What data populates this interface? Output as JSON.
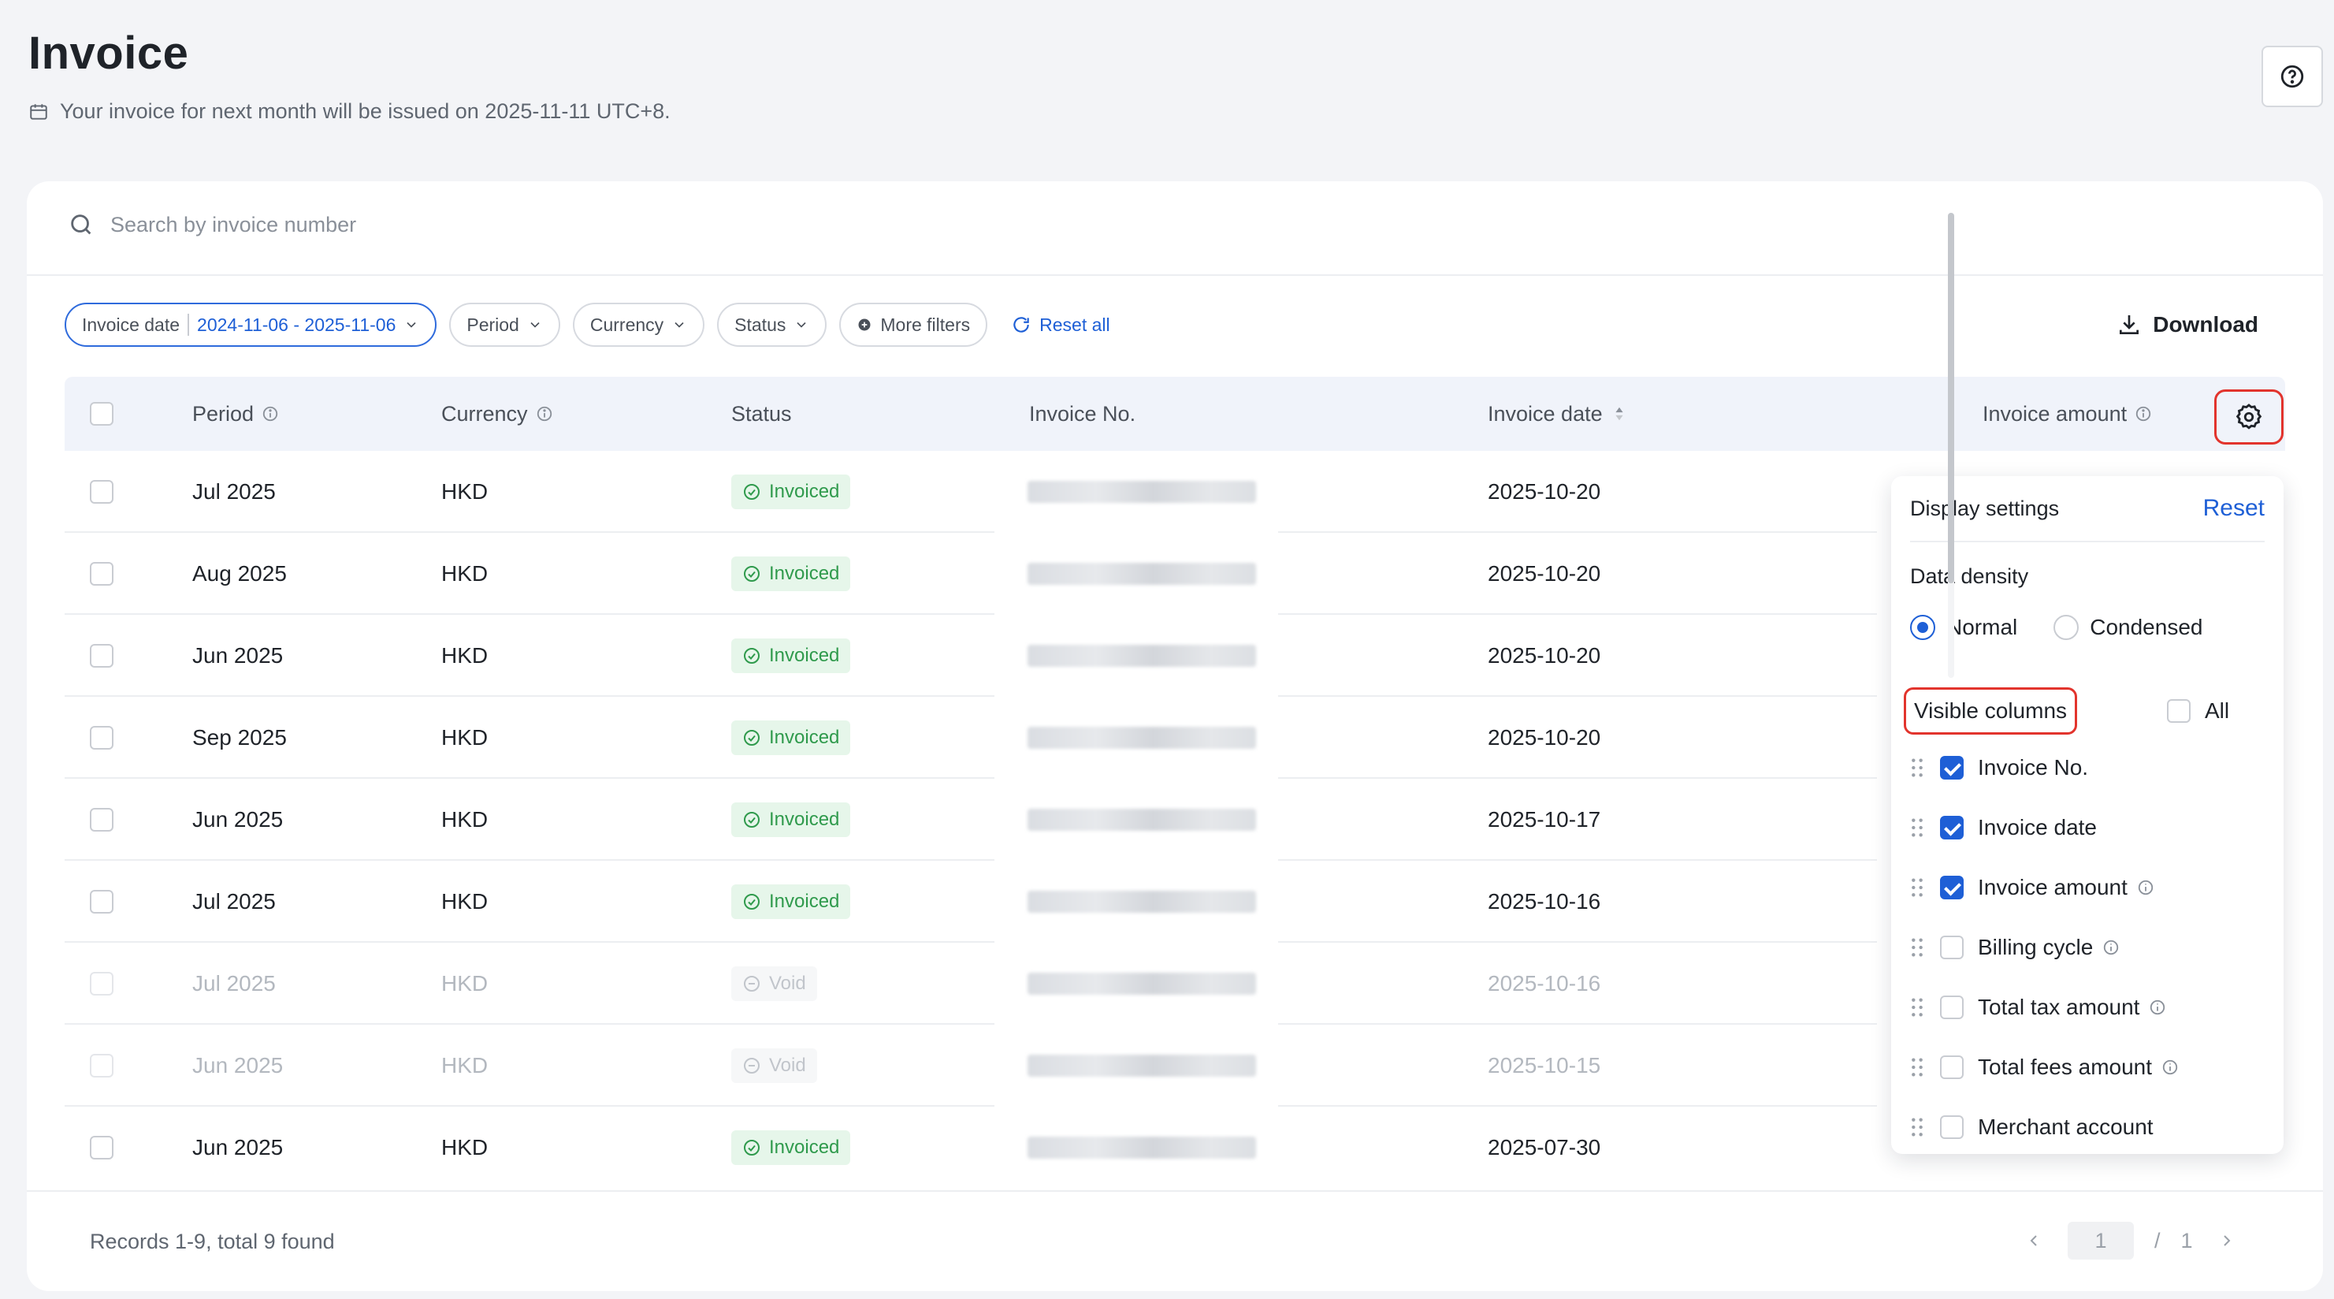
{
  "header": {
    "title": "Invoice",
    "subtitle": "Your invoice for next month will be issued on 2025-11-11 UTC+8."
  },
  "search": {
    "placeholder": "Search by invoice number"
  },
  "filters": {
    "invoice_date_label": "Invoice date",
    "invoice_date_value": "2024-11-06 - 2025-11-06",
    "period": "Period",
    "currency": "Currency",
    "status": "Status",
    "more_filters": "More filters",
    "reset_all": "Reset all"
  },
  "toolbar": {
    "download": "Download"
  },
  "table": {
    "columns": {
      "period": "Period",
      "currency": "Currency",
      "status": "Status",
      "invoice_no": "Invoice No.",
      "invoice_date": "Invoice date",
      "invoice_amount": "Invoice amount"
    },
    "rows": [
      {
        "period": "Jul 2025",
        "currency": "HKD",
        "status": "Invoiced",
        "invoice_date": "2025-10-20"
      },
      {
        "period": "Aug 2025",
        "currency": "HKD",
        "status": "Invoiced",
        "invoice_date": "2025-10-20"
      },
      {
        "period": "Jun 2025",
        "currency": "HKD",
        "status": "Invoiced",
        "invoice_date": "2025-10-20"
      },
      {
        "period": "Sep 2025",
        "currency": "HKD",
        "status": "Invoiced",
        "invoice_date": "2025-10-20"
      },
      {
        "period": "Jun 2025",
        "currency": "HKD",
        "status": "Invoiced",
        "invoice_date": "2025-10-17"
      },
      {
        "period": "Jul 2025",
        "currency": "HKD",
        "status": "Invoiced",
        "invoice_date": "2025-10-16"
      },
      {
        "period": "Jul 2025",
        "currency": "HKD",
        "status": "Void",
        "invoice_date": "2025-10-16"
      },
      {
        "period": "Jun 2025",
        "currency": "HKD",
        "status": "Void",
        "invoice_date": "2025-10-15"
      },
      {
        "period": "Jun 2025",
        "currency": "HKD",
        "status": "Invoiced",
        "invoice_date": "2025-07-30"
      }
    ]
  },
  "footer": {
    "records": "Records 1-9, total 9 found",
    "current_page": "1",
    "page_sep": "/",
    "total_pages": "1"
  },
  "display_settings": {
    "title": "Display settings",
    "reset": "Reset",
    "density_label": "Data density",
    "density_options": [
      "Normal",
      "Condensed"
    ],
    "density_selected": "Normal",
    "visible_columns_label": "Visible columns",
    "all_label": "All",
    "columns": [
      {
        "label": "Invoice No.",
        "checked": true,
        "info": false
      },
      {
        "label": "Invoice date",
        "checked": true,
        "info": false
      },
      {
        "label": "Invoice amount",
        "checked": true,
        "info": true
      },
      {
        "label": "Billing cycle",
        "checked": false,
        "info": true
      },
      {
        "label": "Total tax amount",
        "checked": false,
        "info": true
      },
      {
        "label": "Total fees amount",
        "checked": false,
        "info": true
      },
      {
        "label": "Merchant account",
        "checked": false,
        "info": false
      }
    ]
  },
  "colors": {
    "accent": "#1e5fd6",
    "highlight": "#e2342d",
    "success_bg": "#e6f6ea",
    "success_text": "#2f9a4c"
  },
  "icons": [
    "calendar-icon",
    "help-icon",
    "search-icon",
    "chevron-down-icon",
    "plus-circle-icon",
    "refresh-icon",
    "download-icon",
    "info-icon",
    "sort-icon",
    "gear-icon",
    "check-circle-icon",
    "void-icon",
    "drag-handle-icon",
    "chevron-left-icon",
    "chevron-right-icon"
  ]
}
